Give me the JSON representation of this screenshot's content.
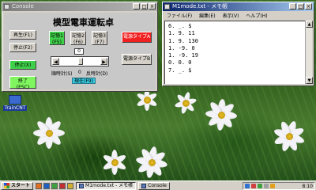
{
  "desktop": {
    "icon_label": "TrainCNT"
  },
  "console": {
    "window_title": "Console",
    "app_title": "模型電車運転卓",
    "buttons": {
      "replay": "再生(F1)",
      "stop": "停止(F2)",
      "stop_x": "停止(X)",
      "exit": "終了\n(ESC)",
      "mem1": "記憶1\n(F5)",
      "mem2": "記憶2\n(F6)",
      "mem3": "記憶3\n(F7)",
      "power_a": "電源タイプA",
      "power_b": "電源タイプB"
    },
    "counter_value": "0",
    "direction": {
      "cw": "順時計(S)",
      "zero": "0",
      "ccw": "反時計(D)"
    },
    "status": "現在(F9)"
  },
  "notepad": {
    "window_title": "M1mode.txt - メモ帳",
    "menu": [
      "ファイル(F)",
      "編集(E)",
      "表示(V)",
      "ヘルプ(H)"
    ],
    "lines": [
      "6. _. $",
      "1. 9. 11",
      "1. 9. 130",
      "1. -9. 0",
      "1. -9. 19",
      "0. 0. 0",
      "7. _. $"
    ]
  },
  "taskbar": {
    "start_label": "スタート",
    "tasks": [
      "M1mode.txt - メモ帳",
      "Console"
    ],
    "clock": "8:10"
  },
  "colors": {
    "title_active": "#0a246a",
    "title_inactive": "#7f7f7f",
    "btn_green": "#3fd04a",
    "btn_red": "#f02020",
    "status_cyan": "#35c8e0"
  }
}
